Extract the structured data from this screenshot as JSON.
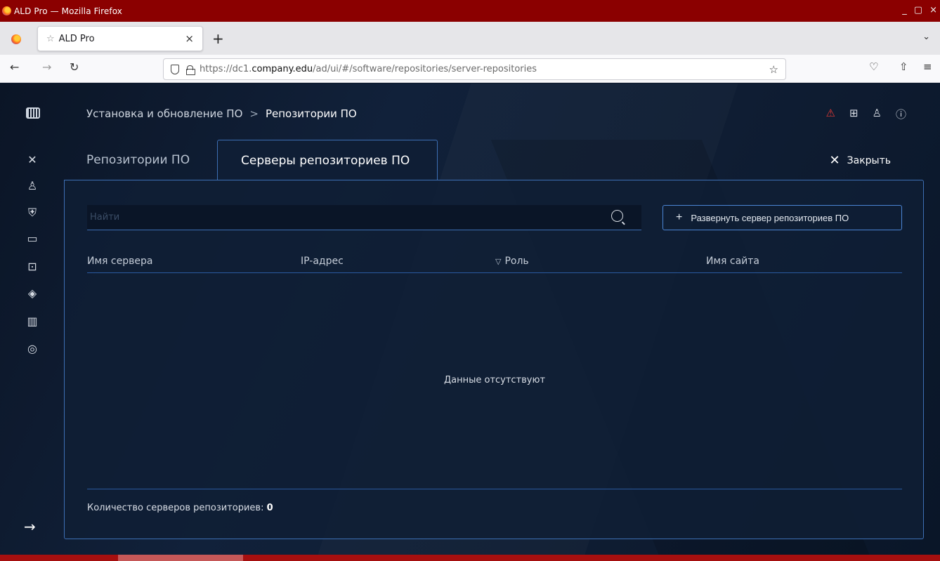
{
  "window": {
    "title": "ALD Pro — Mozilla Firefox",
    "controls": [
      "_",
      "▢",
      "×"
    ]
  },
  "browser": {
    "tab_title": "ALD Pro",
    "tab_close": "×",
    "new_tab": "+",
    "tabs_menu": "⌄",
    "url_host_prefix": "https://dc1.",
    "url_host_bold": "company.edu",
    "url_path": "/ad/ui/#/software/repositories/server-repositories",
    "nav": {
      "back": "←",
      "forward": "→",
      "reload": "↻",
      "bookmark": "☆",
      "pocket": "♡",
      "extensions": "⇧",
      "menu": "≡"
    }
  },
  "app": {
    "breadcrumb": {
      "parent": "Установка и обновление ПО",
      "separator": ">",
      "current": "Репозитории ПО"
    },
    "header_icons": {
      "alert": "📡",
      "network": "⊞",
      "user": "♙",
      "help": "?"
    },
    "tabs": [
      {
        "label": "Репозитории ПО",
        "active": false
      },
      {
        "label": "Серверы репозиториев ПО",
        "active": true
      }
    ],
    "close_label": "Закрыть",
    "search": {
      "placeholder": "Найти",
      "value": ""
    },
    "deploy_button": "Развернуть сервер репозиториев ПО",
    "table": {
      "columns": [
        "Имя сервера",
        "IP-адрес",
        "Роль",
        "Имя сайта"
      ],
      "rows": [],
      "empty_text": "Данные отсутствуют"
    },
    "footer": {
      "count_label": "Количество серверов репозиториев:",
      "count_value": "0"
    },
    "sidebar_icons": [
      "tools-icon",
      "user-settings-icon",
      "shield-icon",
      "window-icon",
      "code-file-icon",
      "layers-icon",
      "chart-icon",
      "monitoring-icon"
    ],
    "expand_arrow": "→"
  },
  "colors": {
    "accent": "#3d6fb4",
    "titlebar": "#8b0000",
    "background": "#0d1b2e",
    "alert": "#e53935"
  }
}
